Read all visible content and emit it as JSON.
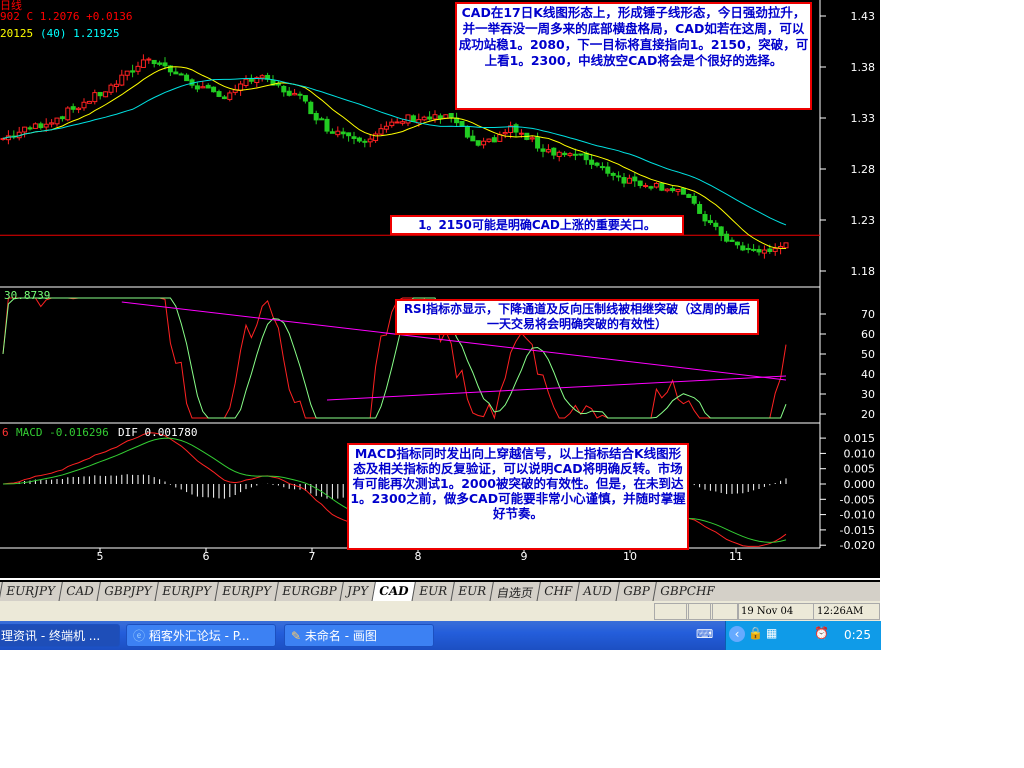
{
  "header": {
    "title_fragment": "日线",
    "price_line": "902 C 1.2076  +0.0136",
    "ma_line_yellow": "20125",
    "ma_line_cyan": "(40) 1.21925"
  },
  "rsi_header": "30.8739",
  "macd_header": {
    "prefix": "6",
    "macd": "MACD -0.016296",
    "dif": "DIF 0.001780"
  },
  "notes": {
    "main": "CAD在17日K线图形态上，形成锤子线形态，今日强劲拉升，并一举吞没一周多来的底部横盘格局，CAD如若在这周，可以成功站稳1。2080，下一目标将直接指向1。2150，突破，可上看1。2300，中线放空CAD将会是个很好的选择。",
    "level": "1。2150可能是明确CAD上涨的重要关口。",
    "rsi": "RSI指标亦显示，下降通道及反向压制线被相继突破（这周的最后一天交易将会明确突破的有效性）",
    "macd": "MACD指标同时发出向上穿越信号，以上指标结合K线图形态及相关指标的反复验证，可以说明CAD将明确反转。市场有可能再次测试1。2000被突破的有效性。但是，在未到达1。2300之前，做多CAD可能要非常小心谨慎，并随时掌握好节奏。"
  },
  "tabs": [
    "EURJPY",
    "CAD",
    "GBPJPY",
    "EURJPY",
    "EURJPY",
    "EURGBP",
    "JPY",
    "CAD",
    "EUR",
    "EUR",
    "自选页",
    "CHF",
    "AUD",
    "GBP",
    "GBPCHF"
  ],
  "active_tab": 7,
  "status": {
    "date": "19 Nov 04",
    "time": "12:26AM"
  },
  "taskbar": {
    "tasks": [
      "理资讯 - 终端机 ...",
      "稻客外汇论坛 - P...",
      "未命名 - 画图"
    ],
    "clock": "0:25"
  },
  "chart_data": [
    {
      "type": "candlestick",
      "name": "price",
      "ylim": [
        1.16,
        1.445
      ],
      "yticks": [
        "1.43",
        "1.38",
        "1.33",
        "1.28",
        "1.23",
        "1.18"
      ],
      "ytick_values": [
        1.43,
        1.38,
        1.33,
        1.28,
        1.23,
        1.18
      ],
      "xticks": [
        "5",
        "6",
        "7",
        "8",
        "9",
        "10",
        "11"
      ],
      "close_path": [
        [
          0,
          1.31
        ],
        [
          10,
          1.33
        ],
        [
          20,
          1.36
        ],
        [
          27,
          1.39
        ],
        [
          33,
          1.37
        ],
        [
          40,
          1.35
        ],
        [
          47,
          1.37
        ],
        [
          55,
          1.35
        ],
        [
          60,
          1.32
        ],
        [
          67,
          1.31
        ],
        [
          75,
          1.33
        ],
        [
          83,
          1.33
        ],
        [
          88,
          1.3
        ],
        [
          94,
          1.32
        ],
        [
          100,
          1.3
        ],
        [
          108,
          1.29
        ],
        [
          115,
          1.27
        ],
        [
          125,
          1.26
        ],
        [
          132,
          1.22
        ],
        [
          137,
          1.2
        ],
        [
          143,
          1.2
        ],
        [
          145,
          1.2076
        ]
      ],
      "support_level": 1.215,
      "ma_colors": {
        "short": "#ffff00",
        "long": "#00e0e0"
      }
    },
    {
      "type": "line",
      "name": "RSI",
      "ylim": [
        15,
        80
      ],
      "yticks": [
        "70",
        "60",
        "50",
        "40",
        "30",
        "20"
      ],
      "ytick_values": [
        70,
        60,
        50,
        40,
        30,
        20
      ],
      "trendline_upper": [
        [
          22,
          76
        ],
        [
          145,
          37
        ]
      ],
      "trendline_lower": [
        [
          60,
          27
        ],
        [
          145,
          39
        ]
      ]
    },
    {
      "type": "line",
      "name": "MACD",
      "ylim": [
        -0.021,
        0.018
      ],
      "yticks": [
        "0.015",
        "0.010",
        "0.005",
        "0.000",
        "-0.005",
        "-0.010",
        "-0.015",
        "-0.020"
      ],
      "ytick_values": [
        0.015,
        0.01,
        0.005,
        0,
        -0.005,
        -0.01,
        -0.015,
        -0.02
      ]
    }
  ]
}
